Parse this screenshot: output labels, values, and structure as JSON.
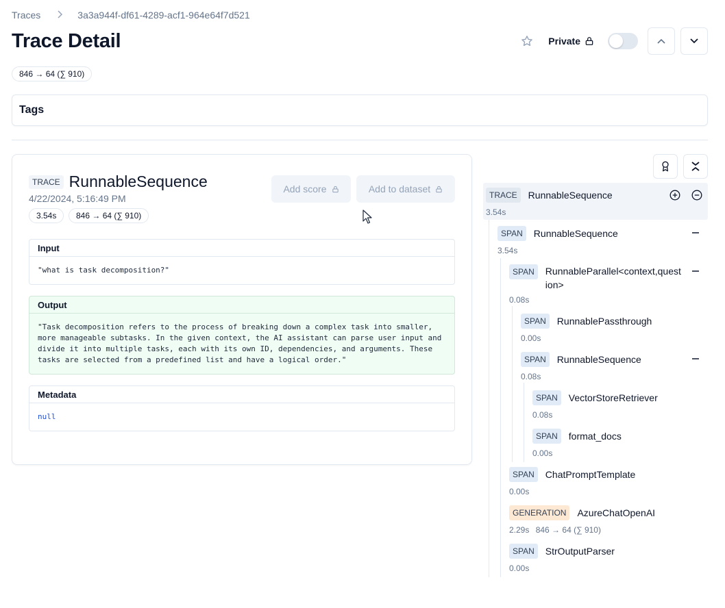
{
  "breadcrumb": {
    "root": "Traces",
    "trace_id": "3a3a944f-df61-4289-acf1-964e64f7d521"
  },
  "page": {
    "title": "Trace Detail",
    "usage": "846 → 64 (∑ 910)",
    "private_label": "Private",
    "tags_label": "Tags"
  },
  "observation": {
    "type": "TRACE",
    "name": "RunnableSequence",
    "timestamp": "4/22/2024, 5:16:49 PM",
    "latency": "3.54s",
    "usage": "846 → 64 (∑ 910)",
    "add_score_label": "Add score",
    "add_dataset_label": "Add to dataset",
    "input_label": "Input",
    "input_value": "\"what is task decomposition?\"",
    "output_label": "Output",
    "output_value": "\"Task decomposition refers to the process of breaking down a complex task into smaller,\nmore manageable subtasks. In the given context, the AI assistant can parse user input and\ndivide it into multiple tasks, each with its own ID, dependencies, and arguments. These\ntasks are selected from a predefined list and have a logical order.\"",
    "metadata_label": "Metadata",
    "metadata_value": "null"
  },
  "tree": {
    "nodes": [
      {
        "type": "TRACE",
        "name": "RunnableSequence",
        "meta": "3.54s"
      },
      {
        "type": "SPAN",
        "name": "RunnableSequence",
        "meta": "3.54s"
      },
      {
        "type": "SPAN",
        "name": "RunnableParallel<context,question>",
        "meta": "0.08s"
      },
      {
        "type": "SPAN",
        "name": "RunnablePassthrough",
        "meta": "0.00s"
      },
      {
        "type": "SPAN",
        "name": "RunnableSequence",
        "meta": "0.08s"
      },
      {
        "type": "SPAN",
        "name": "VectorStoreRetriever",
        "meta": "0.08s"
      },
      {
        "type": "SPAN",
        "name": "format_docs",
        "meta": "0.00s"
      },
      {
        "type": "SPAN",
        "name": "ChatPromptTemplate",
        "meta": "0.00s"
      },
      {
        "type": "GENERATION",
        "name": "AzureChatOpenAI",
        "meta": "2.29s",
        "usage": "846 → 64 (∑ 910)"
      },
      {
        "type": "SPAN",
        "name": "StrOutputParser",
        "meta": "0.00s"
      }
    ]
  },
  "icons": {
    "star": "star-icon",
    "lock": "lock-icon",
    "chevron_up": "chevron-up-icon",
    "chevron_down": "chevron-down-icon",
    "award": "award-icon",
    "collapse": "collapse-all-icon",
    "expand": "plus-circle-icon",
    "collapse_node": "minus-circle-icon",
    "minus": "minus-icon",
    "chevron_right": "chevron-right-icon",
    "cursor": "mouse-pointer-icon"
  },
  "colors": {
    "output_bg": "#f0fdf4",
    "span_tag": "#e0ebf7",
    "generation_tag": "#fde8d4",
    "metadata_text": "#1d4ed8"
  }
}
